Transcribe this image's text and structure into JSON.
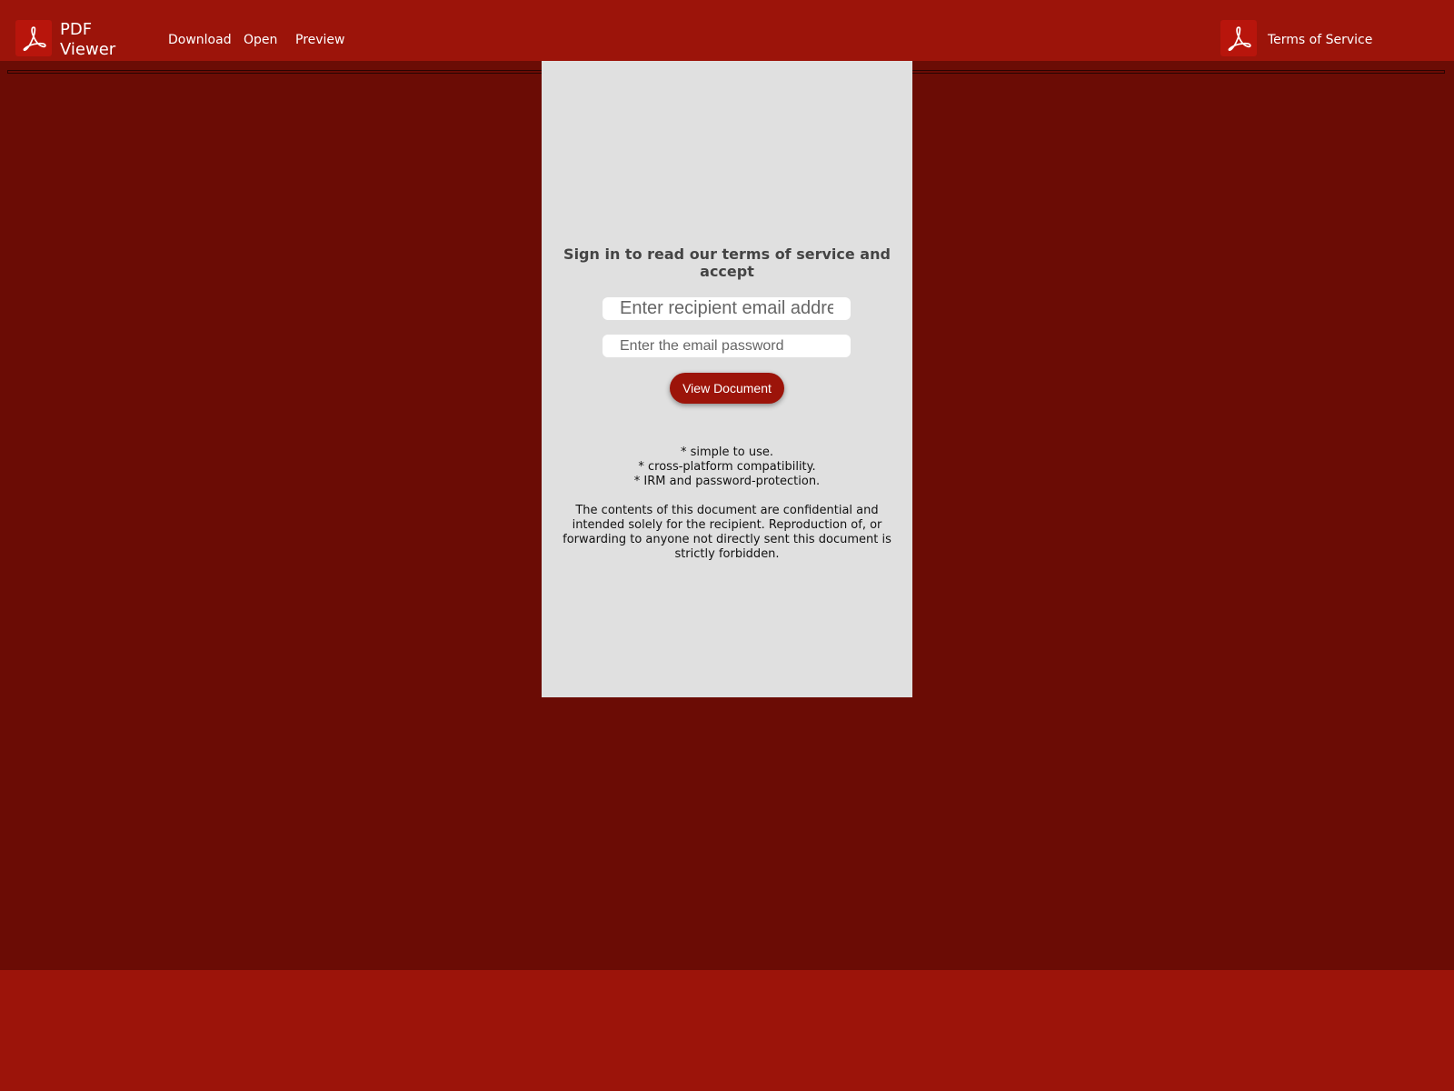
{
  "app": {
    "title": "PDF Viewer",
    "icon": "acrobat-logo-icon"
  },
  "nav": {
    "items": [
      {
        "label": "Download"
      },
      {
        "label": "Open"
      },
      {
        "label": "Preview"
      }
    ],
    "terms_label": "Terms of Service"
  },
  "login": {
    "heading": "Sign in to read our terms of service and accept",
    "email_placeholder": "Enter recipient email address",
    "password_placeholder": "Enter the email password",
    "submit_label": "View Document"
  },
  "features": [
    "* simple to use.",
    "* cross-platform compatibility.",
    "* IRM and password-protection."
  ],
  "notice": "The contents of this document are confidential and intended solely for the recipient. Reproduction of, or forwarding to anyone not directly sent this document is strictly forbidden.",
  "colors": {
    "header_bg": "#9c140a",
    "page_bg": "#6b0c05",
    "panel_bg": "#e0e0e0",
    "button_bg": "#9c140a"
  }
}
